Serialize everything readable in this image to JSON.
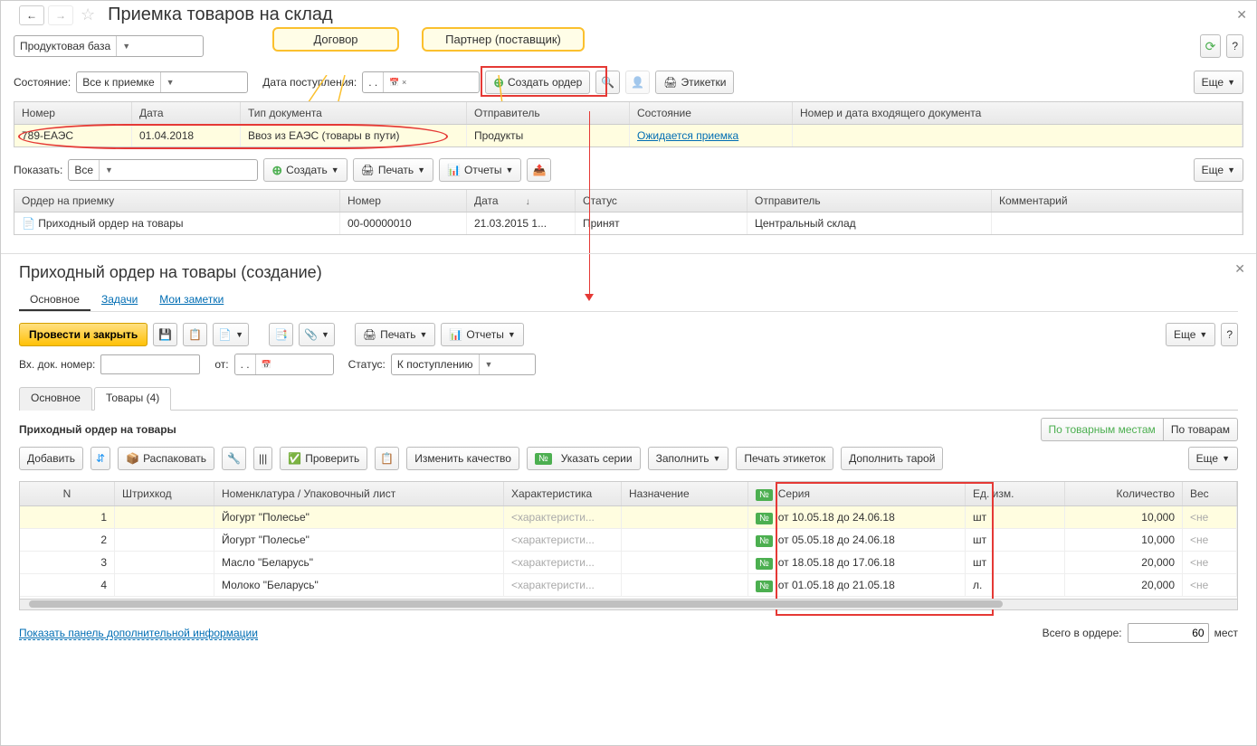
{
  "header": {
    "title": "Приемка товаров на склад",
    "warehouse": "Продуктовая база"
  },
  "callouts": {
    "contract": "Договор",
    "partner": "Партнер (поставщик)"
  },
  "filters": {
    "state_label": "Состояние:",
    "state_value": "Все к приемке",
    "date_label": "Дата поступления:",
    "date_value": ".  .",
    "create_order": "Создать ордер",
    "labels_btn": "Этикетки",
    "more_btn": "Еще"
  },
  "receipts_table": {
    "cols": [
      "Номер",
      "Дата",
      "Тип документа",
      "Отправитель",
      "Состояние",
      "Номер и дата входящего документа"
    ],
    "row": {
      "number": "789-ЕАЭС",
      "date": "01.04.2018",
      "doc_type": "Ввоз из ЕАЭС (товары в пути)",
      "sender": "Продукты",
      "state": "Ожидается приемка"
    }
  },
  "orders_bar": {
    "show_label": "Показать:",
    "show_value": "Все",
    "create": "Создать",
    "print": "Печать",
    "reports": "Отчеты",
    "more": "Еще"
  },
  "orders_table": {
    "cols": [
      "Ордер на приемку",
      "Номер",
      "Дата",
      "Статус",
      "Отправитель",
      "Комментарий"
    ],
    "row": {
      "name": "Приходный ордер на товары",
      "number": "00-00000010",
      "date": "21.03.2015 1...",
      "status": "Принят",
      "sender": "Центральный склад"
    }
  },
  "panel2": {
    "title": "Приходный ордер на товары (создание)",
    "tabs": {
      "main": "Основное",
      "tasks": "Задачи",
      "notes": "Мои заметки"
    },
    "post_close": "Провести и закрыть",
    "print": "Печать",
    "reports": "Отчеты",
    "more": "Еще",
    "fields": {
      "ext_num_label": "Вх. док. номер:",
      "from_label": "от:",
      "from_value": ".  .",
      "status_label": "Статус:",
      "status_value": "К поступлению"
    },
    "subtabs": {
      "main": "Основное",
      "goods": "Товары (4)"
    },
    "goods": {
      "title": "Приходный ордер на товары",
      "by_places": "По товарным местам",
      "by_goods": "По товарам",
      "add": "Добавить",
      "unpack": "Распаковать",
      "check": "Проверить",
      "change_quality": "Изменить качество",
      "set_series": "Указать серии",
      "fill": "Заполнить",
      "print_labels": "Печать этикеток",
      "add_tare": "Дополнить тарой",
      "more": "Еще",
      "cols": [
        "N",
        "Штрихкод",
        "Номенклатура / Упаковочный лист",
        "Характеристика",
        "Назначение",
        "Серия",
        "Ед. изм.",
        "Количество",
        "Вес"
      ],
      "placeholder_char": "<характеристи...",
      "placeholder_ne": "<не",
      "rows": [
        {
          "n": "1",
          "name": "Йогурт \"Полесье\"",
          "serial": "от 10.05.18 до 24.06.18",
          "unit": "шт",
          "qty": "10,000"
        },
        {
          "n": "2",
          "name": "Йогурт \"Полесье\"",
          "serial": "от 05.05.18 до 24.06.18",
          "unit": "шт",
          "qty": "10,000"
        },
        {
          "n": "3",
          "name": "Масло \"Беларусь\"",
          "serial": "от 18.05.18 до 17.06.18",
          "unit": "шт",
          "qty": "20,000"
        },
        {
          "n": "4",
          "name": "Молоко \"Беларусь\"",
          "serial": "от 01.05.18 до 21.05.18",
          "unit": "л.",
          "qty": "20,000"
        }
      ]
    },
    "footer": {
      "panel_link": "Показать панель дополнительной информации",
      "total_label": "Всего в ордере:",
      "total_value": "60",
      "unit": "мест"
    }
  }
}
